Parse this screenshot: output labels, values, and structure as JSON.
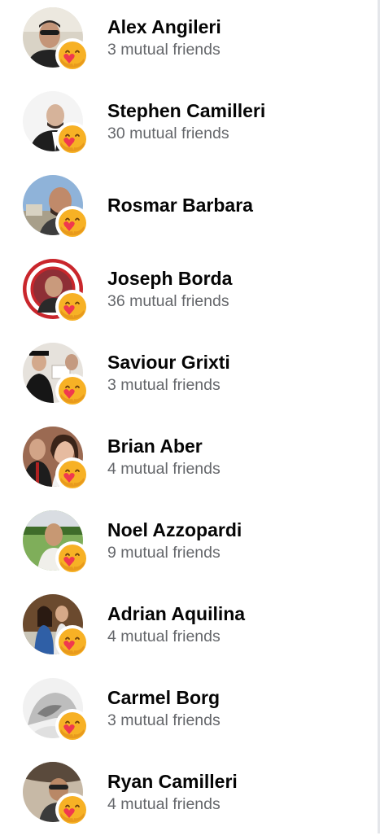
{
  "colors": {
    "name_text": "#050505",
    "secondary_text": "#65676b",
    "care_emoji_face": "#f7b125",
    "care_emoji_heart": "#f0384f"
  },
  "friends": [
    {
      "name": "Alex Angileri",
      "mutual": "3 mutual friends",
      "reaction_icon": "care-reaction-icon"
    },
    {
      "name": "Stephen Camilleri",
      "mutual": "30 mutual friends",
      "reaction_icon": "care-reaction-icon"
    },
    {
      "name": "Rosmar Barbara",
      "mutual": "",
      "reaction_icon": "care-reaction-icon"
    },
    {
      "name": "Joseph Borda",
      "mutual": "36 mutual friends",
      "reaction_icon": "care-reaction-icon"
    },
    {
      "name": "Saviour Grixti",
      "mutual": "3 mutual friends",
      "reaction_icon": "care-reaction-icon"
    },
    {
      "name": "Brian Aber",
      "mutual": "4 mutual friends",
      "reaction_icon": "care-reaction-icon"
    },
    {
      "name": "Noel Azzopardi",
      "mutual": "9 mutual friends",
      "reaction_icon": "care-reaction-icon"
    },
    {
      "name": "Adrian Aquilina",
      "mutual": "4 mutual friends",
      "reaction_icon": "care-reaction-icon"
    },
    {
      "name": "Carmel Borg",
      "mutual": "3 mutual friends",
      "reaction_icon": "care-reaction-icon"
    },
    {
      "name": "Ryan Camilleri",
      "mutual": "4 mutual friends",
      "reaction_icon": "care-reaction-icon"
    }
  ]
}
